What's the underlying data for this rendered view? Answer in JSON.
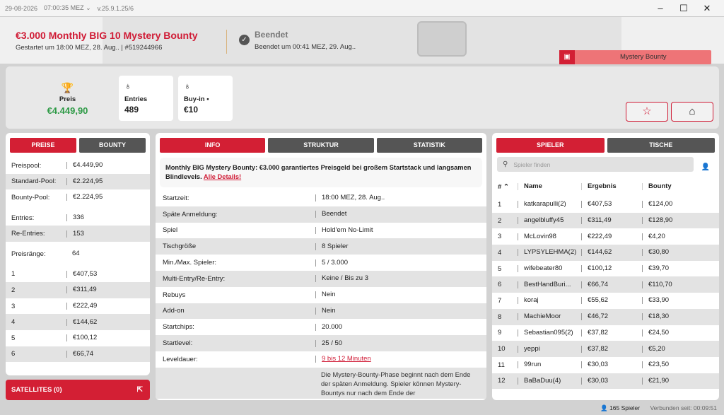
{
  "titlebar": {
    "date": "29-08-2026",
    "time": "07:00:35 MEZ ⌄",
    "version": "v.25.9.1.25/6",
    "minimize": "–",
    "maximize": "☐",
    "close": "✕"
  },
  "header": {
    "title": "€3.000 Monthly BIG 10 Mystery Bounty",
    "subtitle": "Gestartet um 18:00 MEZ, 28. Aug.. | #519244966",
    "status_title": "Beendet",
    "status_sub": "Beendet um 00:41 MEZ, 29. Aug..",
    "badge": "Mystery Bounty",
    "status_icon": "✓",
    "badge_icon": "▣"
  },
  "summary": {
    "prize_label": "Preis",
    "prize_value": "€4.449,90",
    "entries_label": "Entries",
    "entries_value": "489",
    "buyin_label": "Buy-in",
    "buyin_value": "€10",
    "trophy_icon": "🏆",
    "medal_icon": "♁",
    "info_icon": "▪",
    "star_icon": "☆",
    "home_icon": "⌂"
  },
  "left": {
    "tabs": [
      "PREISE",
      "BOUNTY"
    ],
    "rows_a": [
      {
        "k": "Preispool:",
        "v": "€4.449,90"
      },
      {
        "k": "Standard-Pool:",
        "v": "€2.224,95"
      },
      {
        "k": "Bounty-Pool:",
        "v": "€2.224,95"
      }
    ],
    "rows_b": [
      {
        "k": "Entries:",
        "v": "336"
      },
      {
        "k": "Re-Entries:",
        "v": "153"
      }
    ],
    "places": {
      "k": "Preisränge:",
      "v": "64"
    },
    "rows_c": [
      {
        "k": "1",
        "v": "€407,53"
      },
      {
        "k": "2",
        "v": "€311,49"
      },
      {
        "k": "3",
        "v": "€222,49"
      },
      {
        "k": "4",
        "v": "€144,62"
      },
      {
        "k": "5",
        "v": "€100,12"
      },
      {
        "k": "6",
        "v": "€66,74"
      }
    ],
    "satellites": "SATELLITES (0)",
    "ext_icon": "⇱"
  },
  "mid": {
    "tabs": [
      "INFO",
      "STRUKTUR",
      "STATISTIK"
    ],
    "desc": "Monthly BIG Mystery Bounty: €3.000 garantiertes Preisgeld bei großem Startstack und langsamen Blindlevels.",
    "details": "Alle Details!",
    "rows": [
      {
        "k": "Startzeit:",
        "v": "18:00 MEZ, 28. Aug.."
      },
      {
        "k": "Späte Anmeldung:",
        "v": "Beendet"
      },
      {
        "k": "Spiel",
        "v": "Hold'em No-Limit"
      },
      {
        "k": "Tischgröße",
        "v": "8 Spieler"
      },
      {
        "k": "Min./Max. Spieler:",
        "v": "5 / 3.000"
      },
      {
        "k": "Multi-Entry/Re-Entry:",
        "v": "Keine / Bis zu 3"
      },
      {
        "k": "Rebuys",
        "v": "Nein"
      },
      {
        "k": "Add-on",
        "v": "Nein"
      },
      {
        "k": "Startchips:",
        "v": "20.000"
      },
      {
        "k": "Startlevel:",
        "v": "25 / 50"
      }
    ],
    "level_k": "Leveldauer:",
    "level_v": "9 bis 12 Minuten",
    "long_text": "Die Mystery-Bounty-Phase beginnt nach dem Ende der späten Anmeldung. Spieler können Mystery-Bountys nur nach dem Ende der"
  },
  "right": {
    "tabs": [
      "SPIELER",
      "TISCHE"
    ],
    "search_placeholder": "Spieler finden",
    "search_icon": "⚲",
    "user_icon": "👤",
    "headers": [
      "#",
      "Name",
      "Ergebnis",
      "Bounty"
    ],
    "sort_icon": "⌃",
    "players": [
      {
        "n": "1",
        "name": "katkarapulli(2)",
        "res": "€407,53",
        "b": "€124,00"
      },
      {
        "n": "2",
        "name": "angelbluffy45",
        "res": "€311,49",
        "b": "€128,90"
      },
      {
        "n": "3",
        "name": "McLovin98",
        "res": "€222,49",
        "b": "€4,20"
      },
      {
        "n": "4",
        "name": "LYPSYLEHMA(2)",
        "res": "€144,62",
        "b": "€30,80"
      },
      {
        "n": "5",
        "name": "wifebeater80",
        "res": "€100,12",
        "b": "€39,70"
      },
      {
        "n": "6",
        "name": "BestHandBuri...",
        "res": "€66,74",
        "b": "€110,70"
      },
      {
        "n": "7",
        "name": "koraj",
        "res": "€55,62",
        "b": "€33,90"
      },
      {
        "n": "8",
        "name": "MachieMoor",
        "res": "€46,72",
        "b": "€18,30"
      },
      {
        "n": "9",
        "name": "Sebastian095(2)",
        "res": "€37,82",
        "b": "€24,50"
      },
      {
        "n": "10",
        "name": "yeppi",
        "res": "€37,82",
        "b": "€5,20"
      },
      {
        "n": "11",
        "name": "99run",
        "res": "€30,03",
        "b": "€23,50"
      },
      {
        "n": "12",
        "name": "BaBaDuu(4)",
        "res": "€30,03",
        "b": "€21,90"
      }
    ]
  },
  "footer": {
    "player_icon": "👤",
    "players": "165 Spieler",
    "connected": "Verbunden seit: 00:09:51"
  }
}
